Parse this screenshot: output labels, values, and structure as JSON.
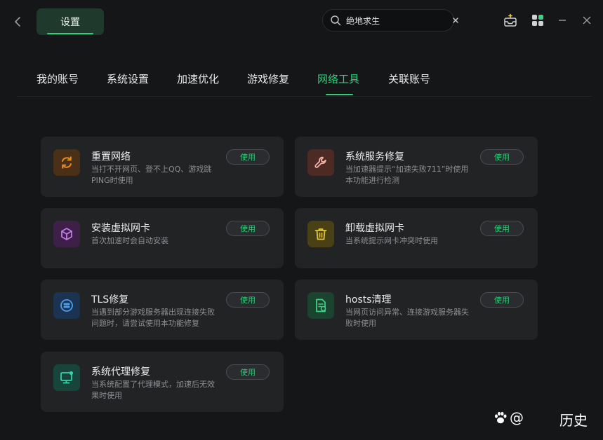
{
  "titlebar": {
    "settings_tab": "设置",
    "search": {
      "value": "绝地求生",
      "placeholder": ""
    }
  },
  "nav": {
    "tabs": [
      {
        "label": "我的账号",
        "active": false
      },
      {
        "label": "系统设置",
        "active": false
      },
      {
        "label": "加速优化",
        "active": false
      },
      {
        "label": "游戏修复",
        "active": false
      },
      {
        "label": "网络工具",
        "active": true
      },
      {
        "label": "关联账号",
        "active": false
      }
    ],
    "active_color": "#35c97a"
  },
  "cards": [
    {
      "title": "重置网络",
      "desc": "当打不开网页、登不上QQ、游戏跳PING时使用",
      "button": "使用",
      "icon": "refresh-icon",
      "color": "#e58a2a"
    },
    {
      "title": "系统服务修复",
      "desc": "当加速器提示“加速失败711”时使用本功能进行检测",
      "button": "使用",
      "icon": "wrench-icon",
      "color": "#e0705a"
    },
    {
      "title": "安装虚拟网卡",
      "desc": "首次加速时会自动安装",
      "button": "使用",
      "icon": "cube-icon",
      "color": "#b06ad8"
    },
    {
      "title": "卸载虚拟网卡",
      "desc": "当系统提示网卡冲突时使用",
      "button": "使用",
      "icon": "trash-icon",
      "color": "#e3c53a"
    },
    {
      "title": "TLS修复",
      "desc": "当遇到部分游戏服务器出现连接失败问题时，请尝试使用本功能修复",
      "button": "使用",
      "icon": "tls-icon",
      "color": "#3b8de0"
    },
    {
      "title": "hosts清理",
      "desc": "当网页访问异常、连接游戏服务器失败时使用",
      "button": "使用",
      "icon": "file-clean-icon",
      "color": "#37c47a"
    },
    {
      "title": "系统代理修复",
      "desc": "当系统配置了代理模式，加速后无效果时使用",
      "button": "使用",
      "icon": "monitor-icon",
      "color": "#33c4a0"
    }
  ],
  "watermark": {
    "text": "@",
    "history": "历史"
  }
}
